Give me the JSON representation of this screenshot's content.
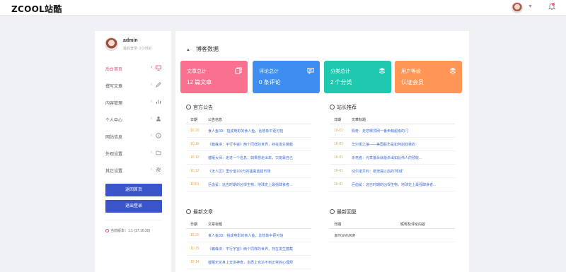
{
  "header": {
    "logo": "ZCOOL站酷",
    "avatar_alt": "user-avatar",
    "dropdown_icon": "caret-down-icon",
    "bell_icon": "bell-icon"
  },
  "profile": {
    "name": "admin",
    "subtitle": "最后登录: 2小时前"
  },
  "sidebar": {
    "items": [
      {
        "label": "后台首页",
        "icon": "monitor-icon",
        "active": true
      },
      {
        "label": "撰写文章",
        "icon": "pencil-icon",
        "active": false
      },
      {
        "label": "内容管理",
        "icon": "bar-chart-icon",
        "active": false
      },
      {
        "label": "个人中心",
        "icon": "user-icon",
        "active": false
      },
      {
        "label": "网站信息",
        "icon": "info-icon",
        "active": false
      },
      {
        "label": "外观设置",
        "icon": "folder-icon",
        "active": false
      },
      {
        "label": "其它设置",
        "icon": "gear-icon",
        "active": false
      }
    ],
    "home_button": "返回首页",
    "logout_button": "退出登录",
    "version": "当前版本：1.1 (17.10.30)"
  },
  "main": {
    "section_title": "博客数据",
    "cards": [
      {
        "title": "文章总计",
        "value": "12 篇文章",
        "color": "#f9718e",
        "icon": "copy-icon"
      },
      {
        "title": "评论总计",
        "value": "0 条评论",
        "color": "#3d8ef0",
        "icon": "comment-icon"
      },
      {
        "title": "分类总计",
        "value": "2 个分类",
        "color": "#1ec9b0",
        "icon": "layers-icon"
      },
      {
        "title": "用户等级",
        "value": "认证会员",
        "color": "#ff9656",
        "icon": "layers-icon"
      }
    ],
    "announcements": {
      "title": "官方公告",
      "columns": [
        "日期",
        "公告信息"
      ],
      "rows": [
        {
          "date": "10.20",
          "text": "食人鱼3D：拍成电影的食人鱼，比想象中更可怕"
        },
        {
          "date": "10.15",
          "text": "《蜘蛛侠：平行宇宙》两个同样的世界，存在发生着截"
        },
        {
          "date": "10.12",
          "text": "催眠大师：走进一个信息，如果想走出来，只能靠自己"
        },
        {
          "date": "10.12",
          "text": "《无人区》里价值100万的猛禽蓝猎市场"
        },
        {
          "date": "10.01",
          "text": "巨齿鲨：远古时期的凶悍生物，地球史上最强肆食者..."
        }
      ]
    },
    "recommend": {
      "title": "站长推荐",
      "columns": [
        "日期",
        "文章标题"
      ],
      "rows": [
        {
          "date": "10-01",
          "text": "佩奇：走您哪顶网一番卖萌超级的门"
        },
        {
          "date": "10-01",
          "text": "华尔街之狼——美国股市是如何割韭菜的"
        },
        {
          "date": "10-01",
          "text": "杀死者：光草莲朵就能杀出如此伟人的预收..."
        },
        {
          "date": "10-01",
          "text": "切尔诺贝利：核泄漏以后的“残城”"
        },
        {
          "date": "10-01",
          "text": "巨齿鲨：远古时期的凶悍生物，地球史上最强肆食者..."
        }
      ]
    },
    "latest": {
      "title": "最新文章",
      "columns": [
        "日期",
        "文章标题"
      ],
      "rows": [
        {
          "date": "10.20",
          "text": "食人鱼3D：拍成电影的食人鱼，比想象中更可怕"
        },
        {
          "date": "10.15",
          "text": "《蜘蛛侠：平行宇宙》两个同样的世界，存在发生着截"
        },
        {
          "date": "10.14",
          "text": "催眠无论身上去多神奇，本质上也达不到正常的心理规"
        }
      ]
    },
    "comments": {
      "title": "最新回复",
      "columns": [
        "日期",
        "昵称及评论内容"
      ],
      "empty_text": "暂时没有回复"
    }
  }
}
